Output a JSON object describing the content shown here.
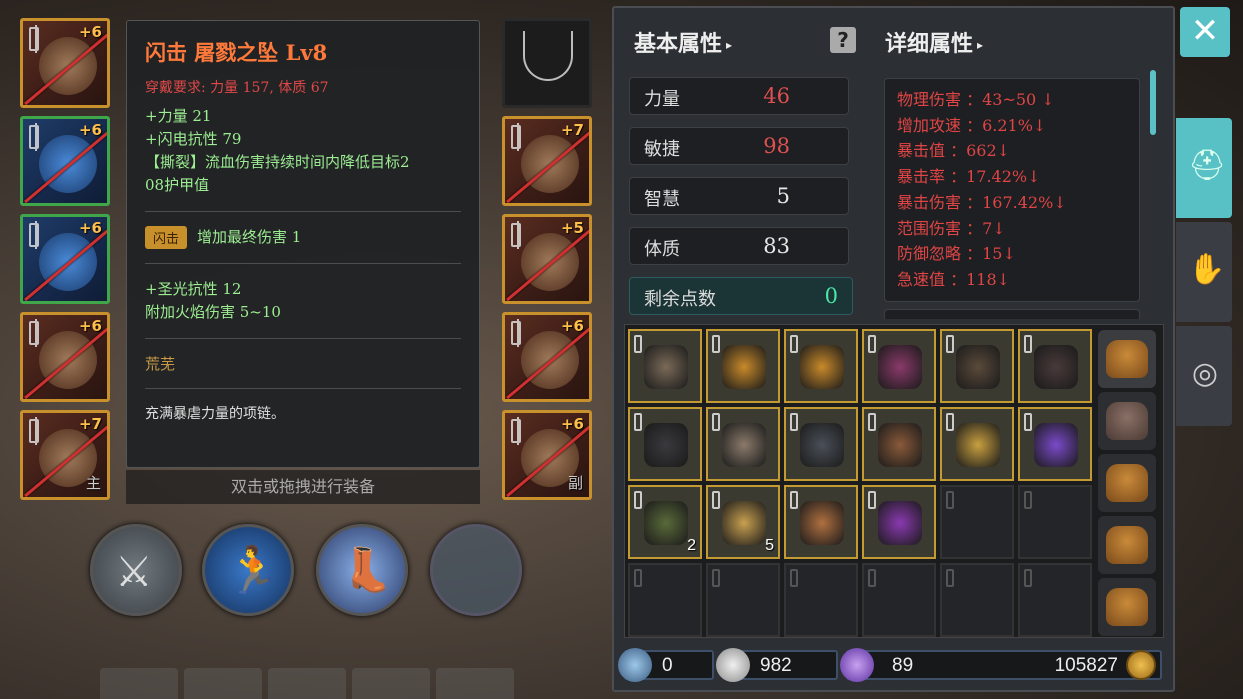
{
  "tooltip": {
    "title": "闪击 屠戮之坠 Lv8",
    "requirement": "穿戴要求:  力量 157, 体质 67",
    "stats": [
      "+力量 21",
      "+闪电抗性 79",
      "【撕裂】流血伤害持续时间内降低目标2",
      "08护甲值"
    ],
    "skill_badge": "闪击",
    "skill_text": "增加最终伤害 1",
    "extra_stats": [
      "+圣光抗性 12",
      "附加火焰伤害 5~10"
    ],
    "rarity": "荒芜",
    "description": "充满暴虐力量的项链。",
    "hint": "双击或拖拽进行装备"
  },
  "equipment": {
    "left": [
      {
        "name": "helmet",
        "plus": "+6",
        "style": "red"
      },
      {
        "name": "chest",
        "plus": "+6",
        "style": "green"
      },
      {
        "name": "legs",
        "plus": "+6",
        "style": "green"
      },
      {
        "name": "ring",
        "plus": "+6",
        "style": "red"
      },
      {
        "name": "main-hand",
        "plus": "+7",
        "style": "red",
        "hand": "主"
      }
    ],
    "right": [
      {
        "name": "necklace",
        "plus": "",
        "style": "dark"
      },
      {
        "name": "gloves",
        "plus": "+7",
        "style": "red"
      },
      {
        "name": "boots",
        "plus": "+5",
        "style": "red"
      },
      {
        "name": "ring2",
        "plus": "+6",
        "style": "red"
      },
      {
        "name": "off-hand",
        "plus": "+6",
        "style": "red",
        "hand": "副"
      }
    ]
  },
  "panel": {
    "basic_header": "基本属性",
    "detail_header": "详细属性",
    "help": "?",
    "stats": [
      {
        "name": "力量",
        "value": "46",
        "color": "#e05050"
      },
      {
        "name": "敏捷",
        "value": "98",
        "color": "#e05050"
      },
      {
        "name": "智慧",
        "value": "5",
        "color": "#e8e8e8"
      },
      {
        "name": "体质",
        "value": "83",
        "color": "#e8e8e8"
      }
    ],
    "remain_label": "剩余点数",
    "remain_value": "0",
    "details": [
      "物理伤害 ：43~50 ↓",
      "增加攻速 ：6.21%↓",
      "暴击值 ：662↓",
      "暴击率 ：17.42%↓",
      "暴击伤害 ：167.42%↓",
      "范围伤害 ：7↓",
      "防御忽略 ：15↓",
      "急速值 ：118↓"
    ]
  },
  "inventory": {
    "cells": [
      {
        "filled": true,
        "color": "#7a6a58",
        "count": ""
      },
      {
        "filled": true,
        "color": "#c98a2a",
        "count": ""
      },
      {
        "filled": true,
        "color": "#c98a2a",
        "count": ""
      },
      {
        "filled": true,
        "color": "#8a3a6a",
        "count": ""
      },
      {
        "filled": true,
        "color": "#5a4a3a",
        "count": ""
      },
      {
        "filled": true,
        "color": "#4a3a3a",
        "count": ""
      },
      {
        "filled": true,
        "color": "#3a3a3e",
        "count": ""
      },
      {
        "filled": true,
        "color": "#8a7a6a",
        "count": ""
      },
      {
        "filled": true,
        "color": "#4a5058",
        "count": ""
      },
      {
        "filled": true,
        "color": "#8a5a3a",
        "count": ""
      },
      {
        "filled": true,
        "color": "#c9a040",
        "count": ""
      },
      {
        "filled": true,
        "color": "#7a4ac9",
        "count": ""
      },
      {
        "filled": true,
        "color": "#5a6a3a",
        "count": "2"
      },
      {
        "filled": true,
        "color": "#c9a050",
        "count": "5"
      },
      {
        "filled": true,
        "color": "#b07040",
        "count": ""
      },
      {
        "filled": true,
        "color": "#8a3ab0",
        "count": ""
      },
      {
        "filled": false,
        "count": ""
      },
      {
        "filled": false,
        "count": ""
      },
      {
        "filled": false,
        "count": ""
      },
      {
        "filled": false,
        "count": ""
      },
      {
        "filled": false,
        "count": ""
      },
      {
        "filled": false,
        "count": ""
      },
      {
        "filled": false,
        "count": ""
      },
      {
        "filled": false,
        "count": ""
      }
    ]
  },
  "currency": {
    "gems": "0",
    "shards": "982",
    "crystals": "89",
    "gold": "105827"
  },
  "close_label": "✕"
}
